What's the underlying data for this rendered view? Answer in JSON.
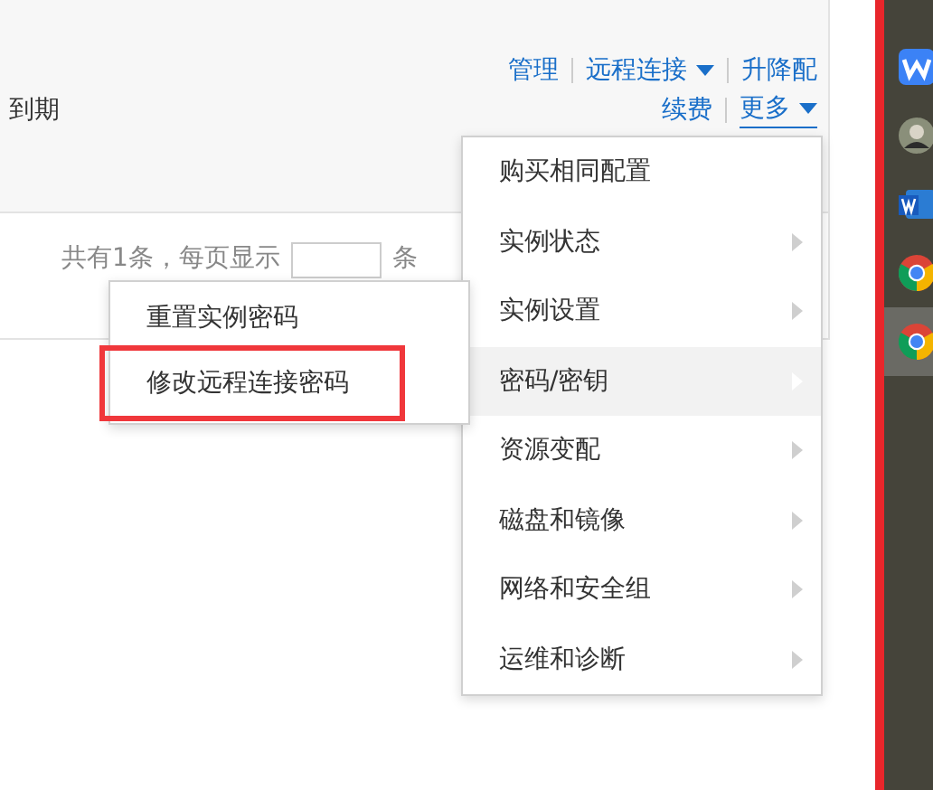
{
  "header": {
    "actions_row_1": [
      {
        "label": "管理",
        "caret": false,
        "underlined": false
      },
      {
        "label": "远程连接",
        "caret": true,
        "underlined": false
      },
      {
        "label": "升降配",
        "caret": false,
        "underlined": false
      }
    ],
    "expiry_label": "到期",
    "actions_row_2": [
      {
        "label": "续费",
        "caret": false,
        "underlined": false
      },
      {
        "label": "更多",
        "caret": true,
        "underlined": true
      }
    ]
  },
  "pagination": {
    "total_text": "共有1条，每页显示",
    "unit": "条"
  },
  "more_menu": [
    {
      "label": "购买相同配置",
      "has_submenu": false,
      "selected": false
    },
    {
      "label": "实例状态",
      "has_submenu": true,
      "selected": false
    },
    {
      "label": "实例设置",
      "has_submenu": true,
      "selected": false
    },
    {
      "label": "密码/密钥",
      "has_submenu": true,
      "selected": true
    },
    {
      "label": "资源变配",
      "has_submenu": true,
      "selected": false
    },
    {
      "label": "磁盘和镜像",
      "has_submenu": true,
      "selected": false
    },
    {
      "label": "网络和安全组",
      "has_submenu": true,
      "selected": false
    },
    {
      "label": "运维和诊断",
      "has_submenu": true,
      "selected": false
    }
  ],
  "submenu": [
    {
      "label": "重置实例密码",
      "highlighted": false
    },
    {
      "label": "修改远程连接密码",
      "highlighted": true
    }
  ],
  "taskbar": [
    {
      "kind": "wps",
      "selected": false
    },
    {
      "kind": "avatar",
      "selected": false
    },
    {
      "kind": "word",
      "selected": false
    },
    {
      "kind": "chrome",
      "selected": false
    },
    {
      "kind": "chrome",
      "selected": true
    }
  ]
}
